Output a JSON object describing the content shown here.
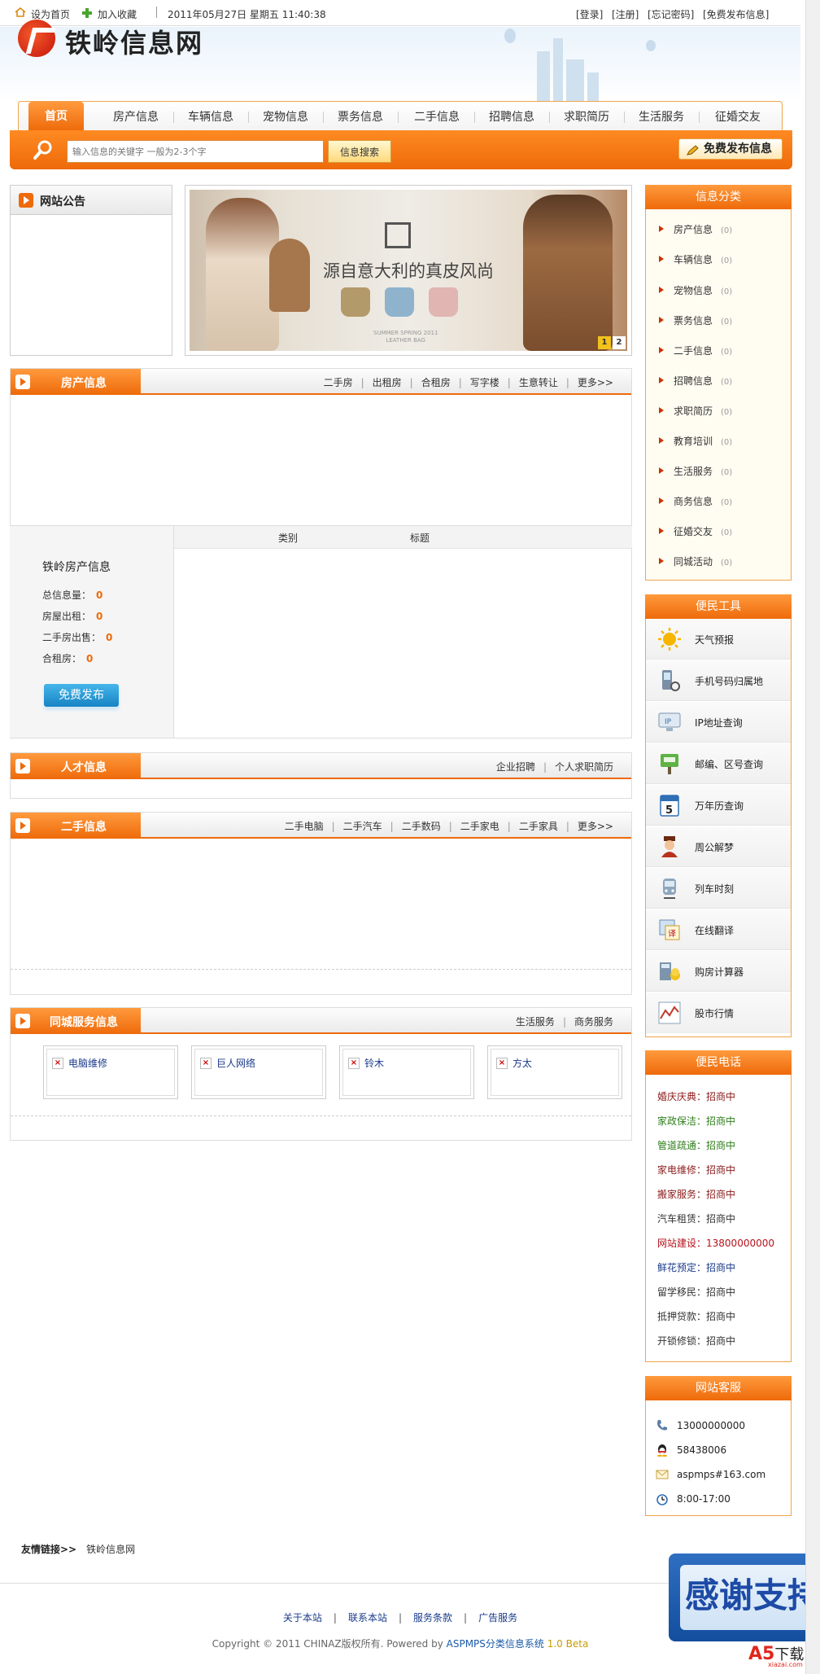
{
  "topbar": {
    "set_home": "设为首页",
    "add_fav": "加入收藏",
    "datetime": "2011年05月27日 星期五 11:40:38",
    "links": [
      "[登录]",
      "[注册]",
      "[忘记密码]",
      "[免费发布信息]"
    ]
  },
  "header": {
    "logo_text": "铁岭信息网"
  },
  "nav": {
    "tabs": [
      "首页",
      "房产信息",
      "车辆信息",
      "宠物信息",
      "票务信息",
      "二手信息",
      "招聘信息",
      "求职简历",
      "生活服务",
      "征婚交友"
    ]
  },
  "search": {
    "placeholder": "输入信息的关键字 一般为2-3个字",
    "button": "信息搜索",
    "post_button": "免费发布信息"
  },
  "notice": {
    "title": "网站公告"
  },
  "banner": {
    "slogan": "源自意大利的真皮风尚",
    "sub1": "SUMMER SPRING 2011",
    "sub2": "LEATHER BAG",
    "pages": [
      "1",
      "2"
    ]
  },
  "house": {
    "title": "房产信息",
    "links": [
      "二手房",
      "出租房",
      "合租房",
      "写字楼",
      "生意转让",
      "更多>>"
    ],
    "stats_title": "铁岭房产信息",
    "stats": [
      {
        "label": "总信息量：",
        "value": "0"
      },
      {
        "label": "房屋出租：",
        "value": "0"
      },
      {
        "label": "二手房出售：",
        "value": "0"
      },
      {
        "label": "合租房：",
        "value": "0"
      }
    ],
    "post_button": "免费发布",
    "table_headers": [
      "类别",
      "标题"
    ]
  },
  "talent": {
    "title": "人才信息",
    "links": [
      "企业招聘",
      "个人求职简历"
    ]
  },
  "secondhand": {
    "title": "二手信息",
    "links": [
      "二手电脑",
      "二手汽车",
      "二手数码",
      "二手家电",
      "二手家具",
      "更多>>"
    ]
  },
  "service": {
    "title": "同城服务信息",
    "links": [
      "生活服务",
      "商务服务"
    ],
    "items": [
      "电脑维修",
      "巨人网络",
      "铃木",
      "方太"
    ]
  },
  "categories": {
    "title": "信息分类",
    "items": [
      {
        "name": "房产信息",
        "count": "(0)"
      },
      {
        "name": "车辆信息",
        "count": "(0)"
      },
      {
        "name": "宠物信息",
        "count": "(0)"
      },
      {
        "name": "票务信息",
        "count": "(0)"
      },
      {
        "name": "二手信息",
        "count": "(0)"
      },
      {
        "name": "招聘信息",
        "count": "(0)"
      },
      {
        "name": "求职简历",
        "count": "(0)"
      },
      {
        "name": "教育培训",
        "count": "(0)"
      },
      {
        "name": "生活服务",
        "count": "(0)"
      },
      {
        "name": "商务信息",
        "count": "(0)"
      },
      {
        "name": "征婚交友",
        "count": "(0)"
      },
      {
        "name": "同城活动",
        "count": "(0)"
      }
    ]
  },
  "tools": {
    "title": "便民工具",
    "items": [
      {
        "label": "天气预报",
        "icon": "sun-icon"
      },
      {
        "label": "手机号码归属地",
        "icon": "mobile-phone-icon"
      },
      {
        "label": "IP地址查询",
        "icon": "ip-monitor-icon"
      },
      {
        "label": "邮编、区号查询",
        "icon": "postbox-icon"
      },
      {
        "label": "万年历查询",
        "icon": "calendar-icon"
      },
      {
        "label": "周公解梦",
        "icon": "zhougong-icon"
      },
      {
        "label": "列车时刻",
        "icon": "train-icon"
      },
      {
        "label": "在线翻译",
        "icon": "translate-icon"
      },
      {
        "label": "购房计算器",
        "icon": "calculator-icon"
      },
      {
        "label": "股市行情",
        "icon": "stock-chart-icon"
      }
    ]
  },
  "phones": {
    "title": "便民电话",
    "items": [
      {
        "label": "婚庆庆典：",
        "value": "招商中",
        "color": "#8b1a1a"
      },
      {
        "label": "家政保洁：",
        "value": "招商中",
        "color": "#2e7d1a"
      },
      {
        "label": "管道疏通：",
        "value": "招商中",
        "color": "#2e7d1a"
      },
      {
        "label": "家电维修：",
        "value": "招商中",
        "color": "#8b1a1a"
      },
      {
        "label": "搬家服务：",
        "value": "招商中",
        "color": "#8b1a1a"
      },
      {
        "label": "汽车租赁：",
        "value": "招商中",
        "color": "#333333"
      },
      {
        "label": "网站建设：",
        "value": "13800000000",
        "color": "#b5121b"
      },
      {
        "label": "鲜花预定：",
        "value": "招商中",
        "color": "#1a3a8a"
      },
      {
        "label": "留学移民：",
        "value": "招商中",
        "color": "#333333"
      },
      {
        "label": "抵押贷款：",
        "value": "招商中",
        "color": "#333333"
      },
      {
        "label": "开锁修锁：",
        "value": "招商中",
        "color": "#333333"
      }
    ]
  },
  "support": {
    "title": "网站客服",
    "items": [
      {
        "text": "13000000000",
        "icon": "phone-icon"
      },
      {
        "text": "58438006",
        "icon": "qq-icon"
      },
      {
        "text": "aspmps#163.com",
        "icon": "mail-icon"
      },
      {
        "text": "8:00-17:00",
        "icon": "clock-icon"
      }
    ]
  },
  "footer": {
    "friends_label": "友情链接>>",
    "friends": [
      "铁岭信息网"
    ],
    "links": [
      "关于本站",
      "联系本站",
      "服务条款",
      "广告服务"
    ],
    "copyright_a": "Copyright © 2011 CHINAZ版权所有. Powered by ",
    "copyright_b": "ASPMPS分类信息系统",
    "copyright_v": " 1.0 Beta"
  },
  "overlay": {
    "thanks": "感谢支持",
    "a5_a": "A5",
    "a5_b": "下载",
    "a5_c": "xiazai.com"
  }
}
